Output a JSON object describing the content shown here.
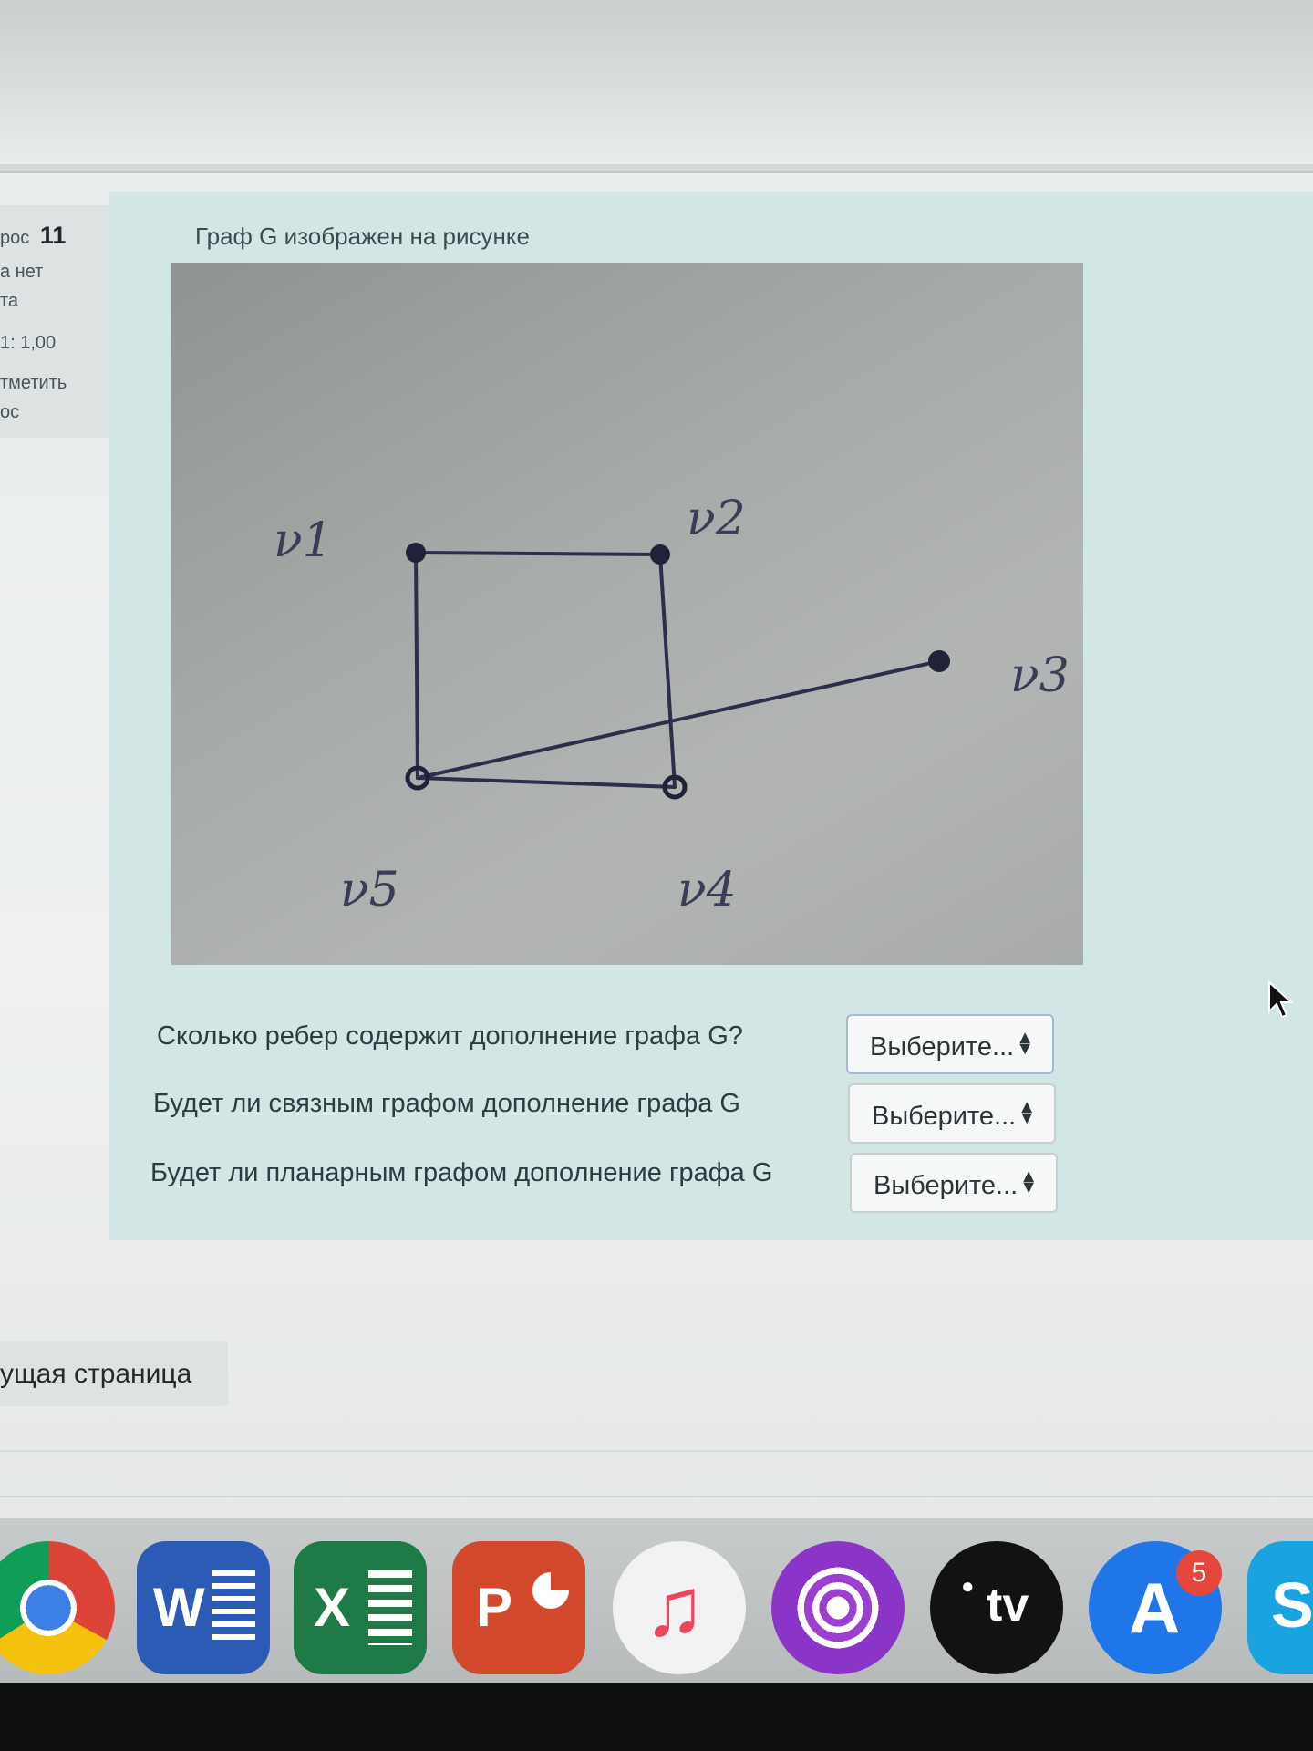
{
  "sidebar": {
    "question_prefix": "рос",
    "question_number": "11",
    "status_line1": "а нет",
    "status_line2": "та",
    "grade": "1: 1,00",
    "flag_line1": "тметить",
    "flag_line2": "ос"
  },
  "question": {
    "text": "Граф G изображен на рисунке",
    "figure_labels": [
      "ν1",
      "ν2",
      "ν3",
      "ν4",
      "ν5"
    ],
    "subquestions": [
      {
        "text": "Сколько ребер содержит дополнение графа G?",
        "select_value": "Выберите..."
      },
      {
        "text": "Будет ли связным графом дополнение графа G",
        "select_value": "Выберите..."
      },
      {
        "text": "Будет ли планарным графом дополнение графа G",
        "select_value": "Выберите..."
      }
    ]
  },
  "navigation": {
    "prev_page_label": "ущая страница"
  },
  "dock": {
    "apps": [
      {
        "name": "chrome-icon",
        "label": ""
      },
      {
        "name": "word-icon",
        "label": "W"
      },
      {
        "name": "excel-icon",
        "label": "X"
      },
      {
        "name": "powerpoint-icon",
        "label": "P"
      },
      {
        "name": "music-icon",
        "label": "♫"
      },
      {
        "name": "podcasts-icon",
        "label": ""
      },
      {
        "name": "apple-tv-icon",
        "label": "tv"
      },
      {
        "name": "app-store-icon",
        "label": "A"
      },
      {
        "name": "skype-icon",
        "label": "S"
      }
    ],
    "app_store_badge": "5"
  }
}
